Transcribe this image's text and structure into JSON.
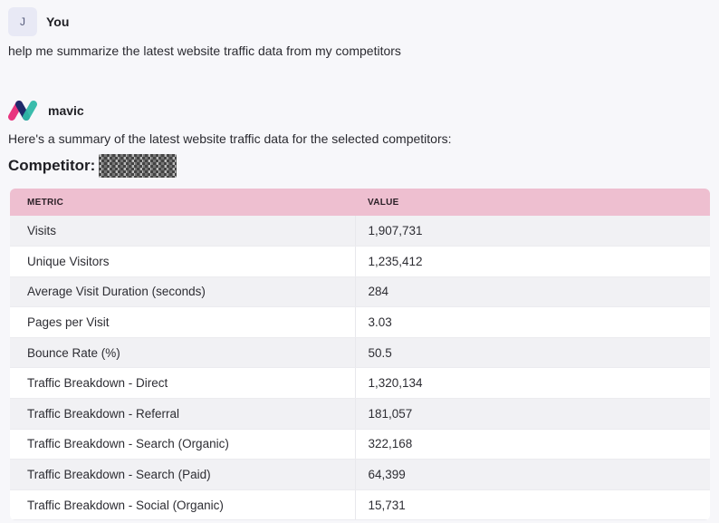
{
  "user": {
    "avatar_initial": "J",
    "name": "You",
    "message": "help me summarize the latest website traffic data from my competitors"
  },
  "assistant": {
    "name": "mavic",
    "message": "Here's a summary of the latest website traffic data for the selected competitors:",
    "competitor_label": "Competitor:"
  },
  "table": {
    "headers": {
      "metric": "METRIC",
      "value": "VALUE"
    },
    "rows": [
      {
        "metric": "Visits",
        "value": "1,907,731"
      },
      {
        "metric": "Unique Visitors",
        "value": "1,235,412"
      },
      {
        "metric": "Average Visit Duration (seconds)",
        "value": "284"
      },
      {
        "metric": "Pages per Visit",
        "value": "3.03"
      },
      {
        "metric": "Bounce Rate (%)",
        "value": "50.5"
      },
      {
        "metric": "Traffic Breakdown - Direct",
        "value": "1,320,134"
      },
      {
        "metric": "Traffic Breakdown - Referral",
        "value": "181,057"
      },
      {
        "metric": "Traffic Breakdown - Search (Organic)",
        "value": "322,168"
      },
      {
        "metric": "Traffic Breakdown - Search (Paid)",
        "value": "64,399"
      },
      {
        "metric": "Traffic Breakdown - Social (Organic)",
        "value": "15,731"
      }
    ]
  },
  "colors": {
    "header_bg": "#eebfd0",
    "logo_pink": "#e8357f",
    "logo_teal": "#2fb8a8",
    "logo_navy": "#1e2a6b"
  },
  "icons": {
    "logo": "mavic-logo-icon",
    "redaction": "redacted-name"
  }
}
